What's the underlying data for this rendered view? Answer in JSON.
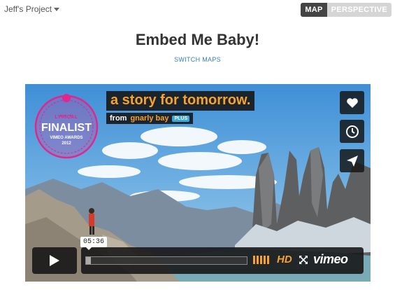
{
  "header": {
    "project_label": "Jeff's Project",
    "view_toggle": {
      "options": [
        "MAP",
        "PERSPECTIVE"
      ],
      "active": "MAP"
    }
  },
  "page": {
    "title": "Embed Me Baby!",
    "switch_link": "SWITCH MAPS"
  },
  "video": {
    "title": "a story for tomorrow.",
    "byline_prefix": "from",
    "byline_user": "gnarly bay",
    "byline_badge": "PLUS",
    "award_badge": {
      "category": "LYRICAL",
      "status": "FINALIST",
      "event": "VIMEO AWARDS",
      "year": "2012"
    },
    "side_buttons": [
      "heart-icon",
      "clock-icon",
      "send-icon"
    ],
    "player": {
      "time": "05:36",
      "progress": 0.03,
      "hd_label": "HD",
      "brand": "vimeo"
    }
  },
  "colors": {
    "accent_orange": "#f8a22d",
    "badge_pink": "#e0268f",
    "link_blue": "#2f7fc8",
    "toggle_active": "#444444",
    "toggle_inactive": "#d5d5d5"
  }
}
